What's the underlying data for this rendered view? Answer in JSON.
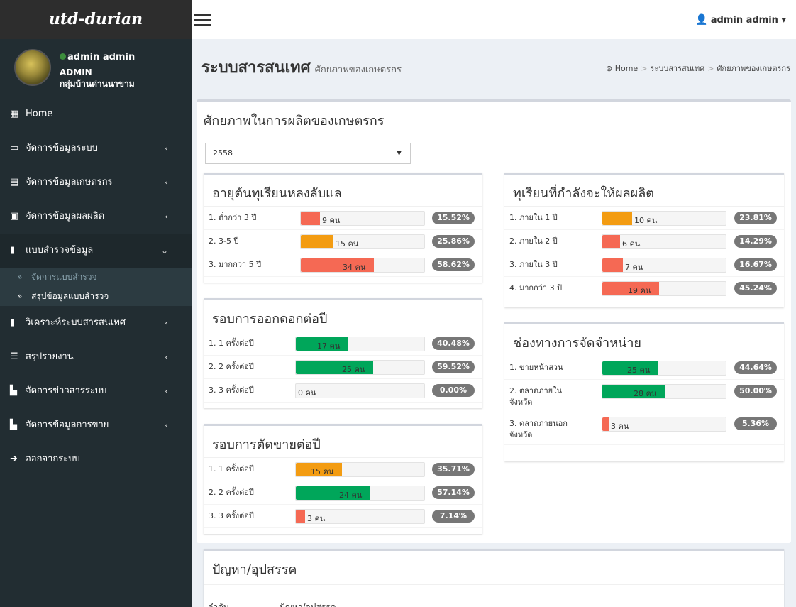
{
  "sidebar": {
    "logo": "utd-durian",
    "user_name": "admin admin",
    "user_role": "ADMIN",
    "user_group": "กลุ่มบ้านด่านนาขาม",
    "nav": [
      {
        "label": "Home",
        "icon": "grid-icon"
      },
      {
        "label": "จัดการข้อมูลระบบ",
        "icon": "monitor-icon"
      },
      {
        "label": "จัดการข้อมูลเกษตรกร",
        "icon": "list-icon"
      },
      {
        "label": "จัดการข้อมูลผลผลิต",
        "icon": "briefcase-icon"
      },
      {
        "label": "แบบสำรวจข้อมูล",
        "icon": "bar-chart-icon"
      },
      {
        "label": "วิเคราะห์ระบบสารสนเทศ",
        "icon": "bar-chart-icon"
      },
      {
        "label": "สรุปรายงาน",
        "icon": "list-icon"
      },
      {
        "label": "จัดการข่าวสารระบบ",
        "icon": "file-icon"
      },
      {
        "label": "จัดการข้อมูลการขาย",
        "icon": "file-icon"
      },
      {
        "label": "ออกจากระบบ",
        "icon": "sign-out-icon"
      }
    ],
    "sub_items": [
      "จัดการแบบสำรวจ",
      "สรุปข้อมูลแบบสำรวจ"
    ]
  },
  "topbar": {
    "user": "admin admin"
  },
  "header": {
    "title": "ระบบสารสนเทศ",
    "subtitle": "ศักยภาพของเกษตรกร",
    "breadcrumb": [
      "Home",
      "ระบบสารสนเทศ",
      "ศักยภาพของเกษตรกร"
    ]
  },
  "main": {
    "title": "ศักยภาพในการผลิตของเกษตรกร",
    "year": "2558"
  },
  "colors": {
    "red": "#f56954",
    "orange": "#f39c12",
    "green": "#00a65a",
    "badge": "#777777"
  },
  "cards": {
    "age": {
      "title": "อายุต้นทุเรียนหลงลับแล",
      "rows": [
        {
          "label": "1.  ต่ำกว่า 3 ปี",
          "text": "9 คน",
          "fraction": 0.1552,
          "color": "red",
          "pct": "15.52%"
        },
        {
          "label": "2.  3-5 ปี",
          "text": "15 คน",
          "fraction": 0.2586,
          "color": "orange",
          "pct": "25.86%"
        },
        {
          "label": "3.  มากกว่า 5 ปี",
          "text": "34 คน",
          "fraction": 0.5862,
          "color": "red",
          "pct": "58.62%"
        }
      ]
    },
    "flower": {
      "title": "รอบการออกดอกต่อปี",
      "rows": [
        {
          "label": "1.  1 ครั้งต่อปี",
          "text": "17 คน",
          "fraction": 0.4048,
          "color": "green",
          "pct": "40.48%"
        },
        {
          "label": "2.  2 ครั้งต่อปี",
          "text": "25 คน",
          "fraction": 0.5952,
          "color": "green",
          "pct": "59.52%"
        },
        {
          "label": "3.  3 ครั้งต่อปี",
          "text": "0 คน",
          "fraction": 0.0,
          "color": "green",
          "pct": "0.00%"
        }
      ]
    },
    "cut": {
      "title": "รอบการตัดขายต่อปี",
      "rows": [
        {
          "label": "1.  1 ครั้งต่อปี",
          "text": "15 คน",
          "fraction": 0.3571,
          "color": "orange",
          "pct": "35.71%"
        },
        {
          "label": "2.  2 ครั้งต่อปี",
          "text": "24 คน",
          "fraction": 0.5714,
          "color": "green",
          "pct": "57.14%"
        },
        {
          "label": "3.  3 ครั้งต่อปี",
          "text": "3 คน",
          "fraction": 0.0714,
          "color": "red",
          "pct": "7.14%"
        }
      ]
    },
    "yield": {
      "title": "ทุเรียนที่กำลังจะให้ผลผลิต",
      "rows": [
        {
          "label": "1.  ภายใน 1 ปี",
          "text": "10 คน",
          "fraction": 0.2381,
          "color": "orange",
          "pct": "23.81%"
        },
        {
          "label": "2.  ภายใน 2 ปี",
          "text": "6 คน",
          "fraction": 0.1429,
          "color": "red",
          "pct": "14.29%"
        },
        {
          "label": "3.  ภายใน 3 ปี",
          "text": "7 คน",
          "fraction": 0.1667,
          "color": "red",
          "pct": "16.67%"
        },
        {
          "label": "4.  มากกว่า 3 ปี",
          "text": "19 คน",
          "fraction": 0.4524,
          "color": "red",
          "pct": "45.24%"
        }
      ]
    },
    "channel": {
      "title": "ช่องทางการจัดจำหน่าย",
      "rows": [
        {
          "label": "1.  ขายหน้าสวน",
          "text": "25 คน",
          "fraction": 0.4464,
          "color": "green",
          "pct": "44.64%"
        },
        {
          "label": "2.  ตลาดภายใน\nจังหวัด",
          "text": "28 คน",
          "fraction": 0.5,
          "color": "green",
          "pct": "50.00%"
        },
        {
          "label": "3.  ตลาดภายนอก\nจังหวัด",
          "text": "3 คน",
          "fraction": 0.0536,
          "color": "red",
          "pct": "5.36%"
        }
      ]
    },
    "problem": {
      "title": "ปัญหา/อุปสรรค",
      "headers": [
        "ลำดับ",
        "ปัญหา/อุปสรรค"
      ]
    }
  }
}
